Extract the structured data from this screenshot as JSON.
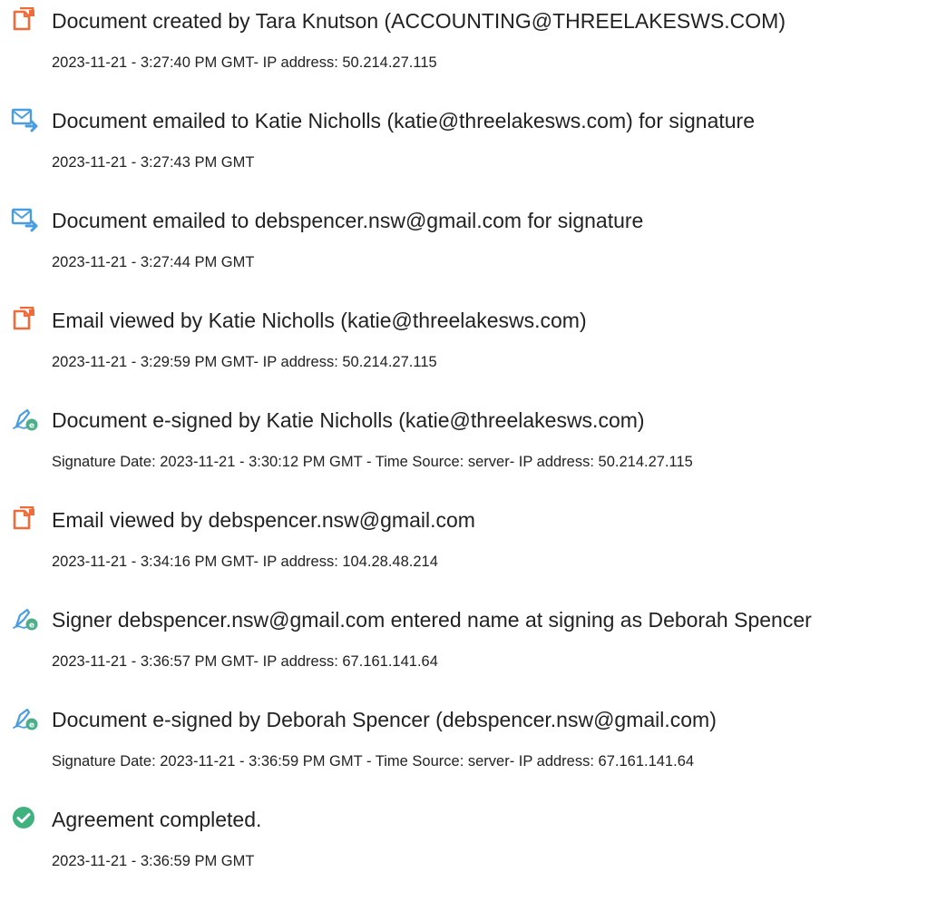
{
  "colors": {
    "document_icon": "#f06b3a",
    "email_icon": "#4a9ee0",
    "sign_icon": "#4caf8a",
    "complete_icon": "#3fb27f",
    "text": "#222222"
  },
  "events": [
    {
      "icon": "document-icon",
      "title": "Document created by Tara Knutson (ACCOUNTING@THREELAKESWS.COM)",
      "detail": "2023-11-21 - 3:27:40 PM GMT- IP address: 50.214.27.115"
    },
    {
      "icon": "email-sent-icon",
      "title": "Document emailed to Katie Nicholls (katie@threelakesws.com) for signature",
      "detail": "2023-11-21 - 3:27:43 PM GMT"
    },
    {
      "icon": "email-sent-icon",
      "title": "Document emailed to debspencer.nsw@gmail.com for signature",
      "detail": "2023-11-21 - 3:27:44 PM GMT"
    },
    {
      "icon": "document-icon",
      "title": "Email viewed by Katie Nicholls (katie@threelakesws.com)",
      "detail": "2023-11-21 - 3:29:59 PM GMT- IP address: 50.214.27.115"
    },
    {
      "icon": "e-sign-icon",
      "title": "Document e-signed by Katie Nicholls (katie@threelakesws.com)",
      "detail": "Signature Date: 2023-11-21 - 3:30:12 PM GMT - Time Source: server- IP address: 50.214.27.115"
    },
    {
      "icon": "document-icon",
      "title": "Email viewed by debspencer.nsw@gmail.com",
      "detail": "2023-11-21 - 3:34:16 PM GMT- IP address: 104.28.48.214"
    },
    {
      "icon": "e-sign-icon",
      "title": "Signer debspencer.nsw@gmail.com entered name at signing as Deborah Spencer",
      "detail": "2023-11-21 - 3:36:57 PM GMT- IP address: 67.161.141.64"
    },
    {
      "icon": "e-sign-icon",
      "title": "Document e-signed by Deborah Spencer (debspencer.nsw@gmail.com)",
      "detail": "Signature Date: 2023-11-21 - 3:36:59 PM GMT - Time Source: server- IP address: 67.161.141.64"
    },
    {
      "icon": "checkmark-icon",
      "title": "Agreement completed.",
      "detail": "2023-11-21 - 3:36:59 PM GMT"
    }
  ]
}
